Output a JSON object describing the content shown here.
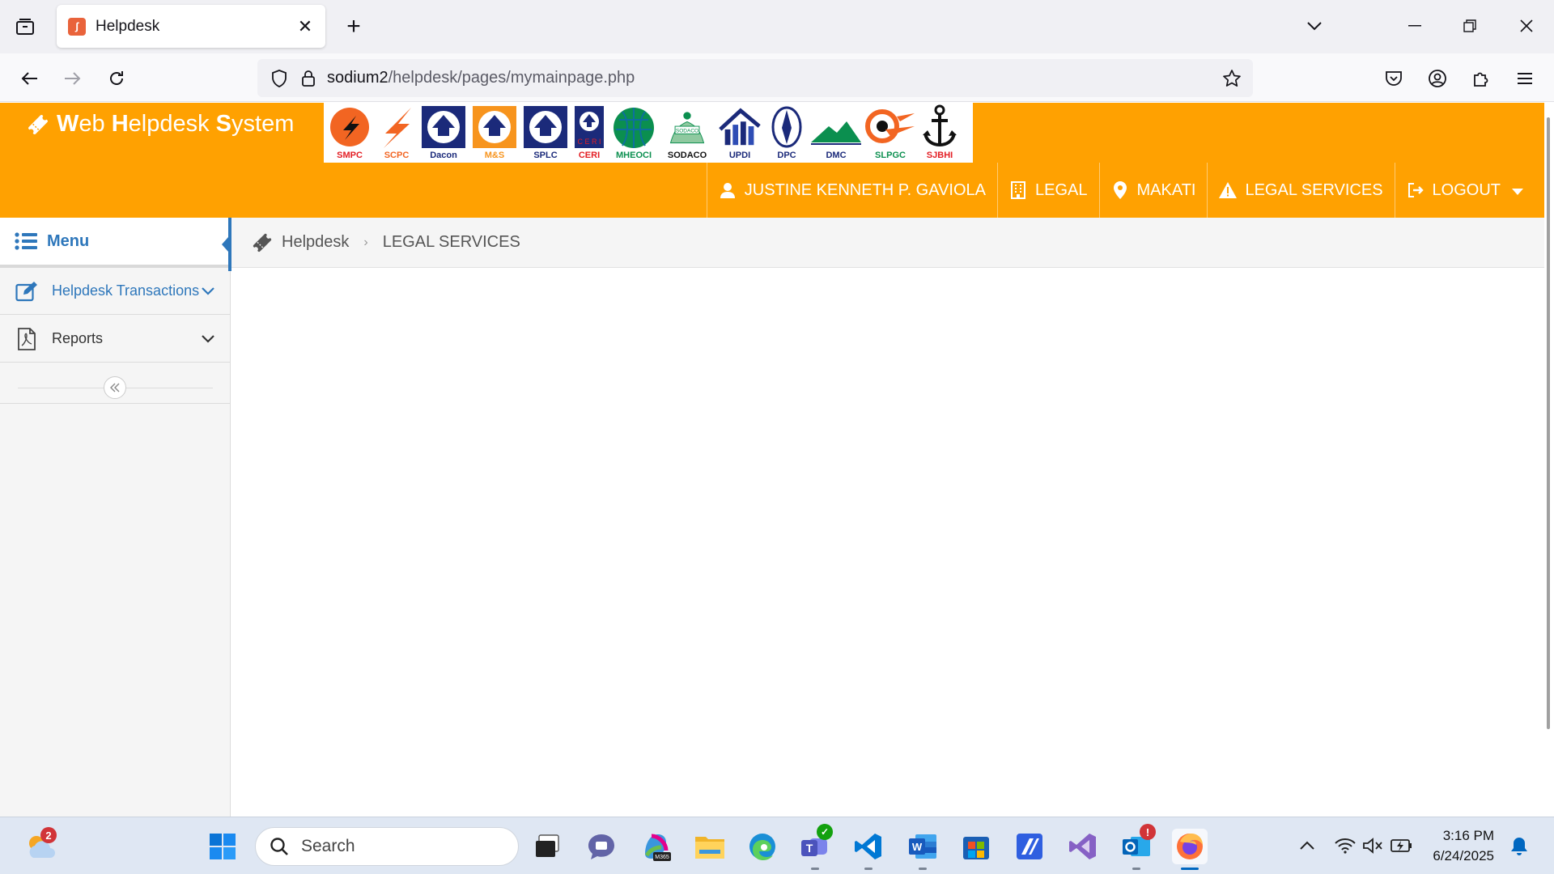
{
  "browser": {
    "tab_title": "Helpdesk",
    "url_host": "sodium2",
    "url_path": "/helpdesk/pages/mymainpage.php"
  },
  "app": {
    "brand": {
      "w": "W",
      "eb": "eb ",
      "h": "H",
      "elpdesk": "elpdesk ",
      "s": "S",
      "ystem": "ystem"
    },
    "logos": [
      {
        "label": "SMPC",
        "color": "#e31e24"
      },
      {
        "label": "SCPC",
        "color": "#f26522"
      },
      {
        "label": "Dacon",
        "color": "#1b2a7a"
      },
      {
        "label": "M&S",
        "color": "#f7941d"
      },
      {
        "label": "SPLC",
        "color": "#1b2a7a"
      },
      {
        "label": "CERI",
        "color": "#e31e24"
      },
      {
        "label": "MHEOCI",
        "color": "#0b8f4f"
      },
      {
        "label": "SODACO",
        "color": "#111111"
      },
      {
        "label": "UPDI",
        "color": "#1b2a7a"
      },
      {
        "label": "DPC",
        "color": "#1b2a7a"
      },
      {
        "label": "DMC",
        "color": "#1b2a7a"
      },
      {
        "label": "SLPGC",
        "color": "#0b8f4f"
      },
      {
        "label": "SJBHI",
        "color": "#e31e24"
      }
    ],
    "topnav": {
      "user": "JUSTINE KENNETH P. GAVIOLA",
      "department": "LEGAL",
      "location": "MAKATI",
      "section": "LEGAL SERVICES",
      "logout": "LOGOUT"
    },
    "accent_color": "#ffa101",
    "menu_color": "#2e77bb"
  },
  "sidebar": {
    "menu_label": "Menu",
    "items": [
      {
        "label": "Helpdesk Transactions"
      },
      {
        "label": "Reports"
      }
    ]
  },
  "breadcrumb": {
    "home": "Helpdesk",
    "current": "LEGAL SERVICES"
  },
  "taskbar": {
    "weather_badge": "2",
    "search_placeholder": "Search",
    "outlook_badge": "!",
    "time": "3:16 PM",
    "date": "6/24/2025"
  }
}
